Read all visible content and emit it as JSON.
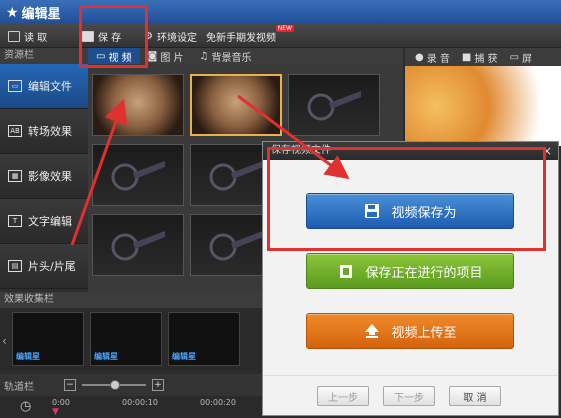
{
  "app": {
    "title": "编辑星"
  },
  "menu": [
    {
      "label": "读 取",
      "icon": "folder-icon"
    },
    {
      "label": "保 存",
      "icon": "save-icon"
    },
    {
      "label": "环境设定",
      "icon": "gear-icon"
    },
    {
      "label": "免新手期发视频",
      "icon": ""
    }
  ],
  "menu_badge": "NEW",
  "resources": {
    "header": "资源栏",
    "tabs": [
      {
        "label": "视 频",
        "icon": "video-icon"
      },
      {
        "label": "图 片",
        "icon": "camera-icon"
      },
      {
        "label": "背景音乐",
        "icon": "music-icon"
      }
    ],
    "sidebar": [
      {
        "label": "编辑文件",
        "icon_text": "▭"
      },
      {
        "label": "转场效果",
        "icon_text": "AB"
      },
      {
        "label": "影像效果",
        "icon_text": "▦"
      },
      {
        "label": "文字编辑",
        "icon_text": "T"
      },
      {
        "label": "片头/片尾",
        "icon_text": "▤"
      }
    ]
  },
  "preview": {
    "tabs": [
      {
        "label": "录 音",
        "icon": "mic-icon"
      },
      {
        "label": "捕 获",
        "icon": "capture-icon"
      },
      {
        "label": "屏",
        "icon": "screen-icon"
      }
    ]
  },
  "effects": {
    "header": "效果收集栏",
    "item_label": "编辑星"
  },
  "timeline": {
    "header": "轨道栏",
    "minus": "−",
    "plus": "+",
    "times": [
      "0:00",
      "00:00:10",
      "00:00:20"
    ]
  },
  "dialog": {
    "title": "保存视频文件",
    "close": "×",
    "buttons": [
      {
        "label": "视频保存为",
        "icon": "floppy-icon"
      },
      {
        "label": "保存正在进行的项目",
        "icon": "project-icon"
      },
      {
        "label": "视频上传至",
        "icon": "upload-icon"
      }
    ],
    "footer": [
      "上一步",
      "下一步",
      "取 消"
    ]
  }
}
